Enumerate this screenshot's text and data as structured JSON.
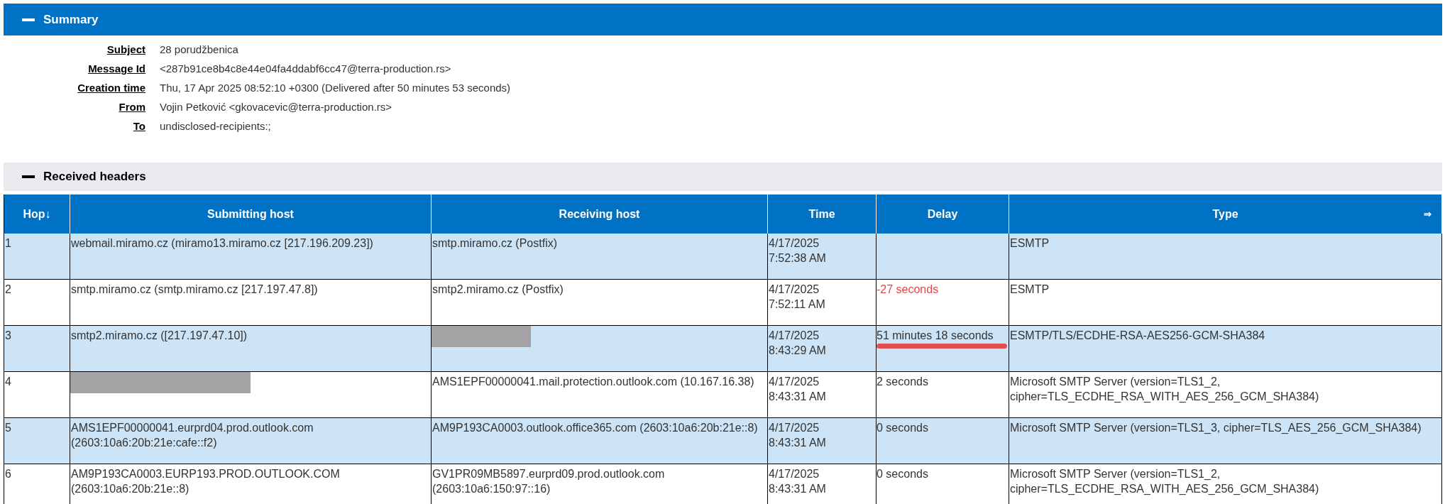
{
  "summary": {
    "title": "Summary",
    "expanded": true,
    "fields": [
      {
        "label": "Subject",
        "value": "28 porudžbenica"
      },
      {
        "label": "Message Id",
        "value": "<287b91ce8b4c8e44e04fa4ddabf6cc47@terra-production.rs>"
      },
      {
        "label": "Creation time",
        "value": "Thu, 17 Apr 2025 08:52:10 +0300 (Delivered after 50 minutes 53 seconds)"
      },
      {
        "label": "From",
        "value": "Vojin Petković <gkovacevic@terra-production.rs>"
      },
      {
        "label": "To",
        "value": "undisclosed-recipients:;"
      }
    ]
  },
  "received_headers": {
    "title": "Received headers",
    "expanded": true,
    "columns": [
      {
        "label": "Hop↓"
      },
      {
        "label": "Submitting host"
      },
      {
        "label": "Receiving host"
      },
      {
        "label": "Time"
      },
      {
        "label": "Delay"
      },
      {
        "label": "Type",
        "extra": "⇒"
      }
    ],
    "rows": [
      {
        "hop": "1",
        "submitting": {
          "kind": "host",
          "text": "webmail.miramo.cz (miramo13.miramo.cz [217.196.209.23])"
        },
        "receiving": {
          "kind": "host",
          "text": "smtp.miramo.cz (Postfix)"
        },
        "time": [
          "4/17/2025",
          "7:52:38 AM"
        ],
        "delay": {
          "negative": false,
          "underlined": false
        },
        "type": "ESMTP"
      },
      {
        "hop": "2",
        "submitting": {
          "kind": "host",
          "text": "smtp.miramo.cz (smtp.miramo.cz [217.197.47.8])"
        },
        "receiving": {
          "kind": "host",
          "text": "smtp2.miramo.cz (Postfix)"
        },
        "time": [
          "4/17/2025",
          "7:52:11 AM"
        ],
        "delay": {
          "text": "-27 seconds",
          "negative": true,
          "underlined": false
        },
        "type": "ESMTP"
      },
      {
        "hop": "3",
        "submitting": {
          "kind": "host",
          "text": "smtp2.miramo.cz ([217.197.47.10])"
        },
        "receiving": {
          "kind": "redacted"
        },
        "time": [
          "4/17/2025",
          "8:43:29 AM"
        ],
        "delay": {
          "text": "51 minutes 18 seconds",
          "negative": false,
          "underlined": true
        },
        "type": "ESMTP/TLS/ECDHE-RSA-AES256-GCM-SHA384"
      },
      {
        "hop": "4",
        "submitting": {
          "kind": "redacted"
        },
        "receiving": {
          "kind": "host",
          "text": "AMS1EPF00000041.mail.protection.outlook.com (10.167.16.38)"
        },
        "time": [
          "4/17/2025",
          "8:43:31 AM"
        ],
        "delay": {
          "text": "2 seconds",
          "negative": false,
          "underlined": false
        },
        "type": "Microsoft SMTP Server (version=TLS1_2, cipher=TLS_ECDHE_RSA_WITH_AES_256_GCM_SHA384)"
      },
      {
        "hop": "5",
        "submitting": {
          "kind": "host",
          "text": "AMS1EPF00000041.eurprd04.prod.outlook.com (2603:10a6:20b:21e:cafe::f2)"
        },
        "receiving": {
          "kind": "host",
          "text": "AM9P193CA0003.outlook.office365.com (2603:10a6:20b:21e::8)"
        },
        "time": [
          "4/17/2025",
          "8:43:31 AM"
        ],
        "delay": {
          "text": "0 seconds",
          "negative": false,
          "underlined": false
        },
        "type": "Microsoft SMTP Server (version=TLS1_3, cipher=TLS_AES_256_GCM_SHA384)"
      },
      {
        "hop": "6",
        "submitting": {
          "kind": "host",
          "text": "AM9P193CA0003.EURP193.PROD.OUTLOOK.COM (2603:10a6:20b:21e::8)"
        },
        "receiving": {
          "kind": "host",
          "text": "GV1PR09MB5897.eurprd09.prod.outlook.com (2603:10a6:150:97::16)"
        },
        "time": [
          "4/17/2025",
          "8:43:31 AM"
        ],
        "delay": {
          "text": "0 seconds",
          "negative": false,
          "underlined": false
        },
        "type": "Microsoft SMTP Server (version=TLS1_2, cipher=TLS_ECDHE_RSA_WITH_AES_256_GCM_SHA384)"
      }
    ]
  }
}
